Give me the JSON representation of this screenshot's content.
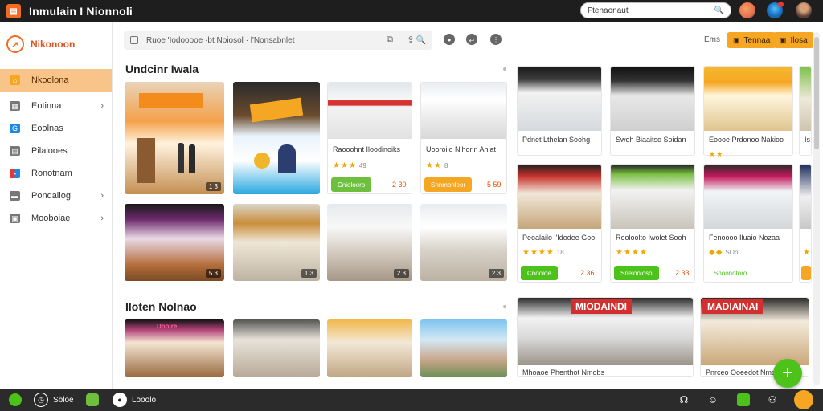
{
  "app": {
    "title": "Inmulain I Nionnoli",
    "logo_glyph": "▤"
  },
  "top_search": {
    "value": "Ftenaonaut",
    "icon": "search-icon"
  },
  "sidebar": {
    "brand": "Nikonoon",
    "items": [
      {
        "label": "Nkoolona",
        "icon": "home-icon",
        "color": "#f5a623",
        "active": true,
        "chevron": false
      },
      {
        "label": "Eotinna",
        "icon": "grid-icon",
        "color": "#666666",
        "active": false,
        "chevron": true
      },
      {
        "label": "Eoolnas",
        "icon": "g-icon",
        "color": "#1e88e5",
        "active": false,
        "chevron": false
      },
      {
        "label": "Pilalooes",
        "icon": "doc-icon",
        "color": "#666666",
        "active": false,
        "chevron": false
      },
      {
        "label": "Ronotnam",
        "icon": "apps-icon",
        "color": "#e53935",
        "active": false,
        "chevron": false
      },
      {
        "label": "Pondaliog",
        "icon": "folder-icon",
        "color": "#666666",
        "active": false,
        "chevron": true
      },
      {
        "label": "Mooboiae",
        "icon": "box-icon",
        "color": "#666666",
        "active": false,
        "chevron": true
      }
    ]
  },
  "toolbar": {
    "search_text": "Ruoe 'Iodooooe ·bt Noiosol · l'Nonsabnlet",
    "label": "Ems",
    "btn1": "Tennaa",
    "btn2": "Ilosa"
  },
  "sections": {
    "s1": "Undcinr Iwala",
    "s2": "Iloten Nolnao"
  },
  "row1_tiles": [
    {
      "cap": "1 3"
    }
  ],
  "row1_cards": [
    {
      "title": "Raooohnt Iloodinoiks",
      "stars": "★★★",
      "count": "49",
      "btn": "Cniolooro",
      "price": "2 30"
    },
    {
      "title": "Uooroilo Nihorin Ahlat",
      "stars": "★★",
      "count": "8",
      "btn": "Snnmonleor",
      "price": "5 59"
    }
  ],
  "row2_tiles": [
    {
      "cap": "5 3"
    },
    {
      "cap": "1 3"
    },
    {
      "cap": "2 3"
    },
    {
      "cap": "2 3"
    }
  ],
  "right_cards_top": [
    {
      "title": "Pdnet Lthelan Soohg",
      "stars": ""
    },
    {
      "title": "Swoh Biaaitso Soidan",
      "stars": ""
    },
    {
      "title": "Eoooe Prdonoo Nakioo",
      "stars": "★★",
      "count": ""
    },
    {
      "title": "Is",
      "stars": ""
    }
  ],
  "right_cards_mid": [
    {
      "title": "Peoalailo l'Idodee Goo",
      "stars": "★★★★",
      "count": "18",
      "btn": "Cnooloe",
      "price": "2 36"
    },
    {
      "title": "Reoloolto Iwolet Sooh",
      "stars": "★★★★",
      "count": "",
      "btn": "Snelooioso",
      "price": "2 33"
    },
    {
      "title": "Fenoooo Iluaio Nozaa",
      "stars": "◆◆",
      "count": "SOo",
      "btn": "Snoonotoro",
      "price": ""
    },
    {
      "title": "",
      "stars": "★",
      "count": "",
      "btn": "",
      "price": ""
    }
  ],
  "bottom_signs": [
    "MIODAINDI",
    "MADIAINAI"
  ],
  "bottom_tiles": [
    {
      "title": ""
    },
    {
      "title": ""
    },
    {
      "title": ""
    },
    {
      "title": "Mhoaoe Phenthot Nmobs"
    },
    {
      "title": "Pnrceo Ooeedot Nmoloa"
    }
  ],
  "bottom_sign_small": "Doolre",
  "taskbar": {
    "item1": "Sbloe",
    "item3": "Looolo"
  },
  "colors": {
    "accent": "#f5a623",
    "green": "#4cc21b",
    "dark": "#1e1e1e"
  }
}
